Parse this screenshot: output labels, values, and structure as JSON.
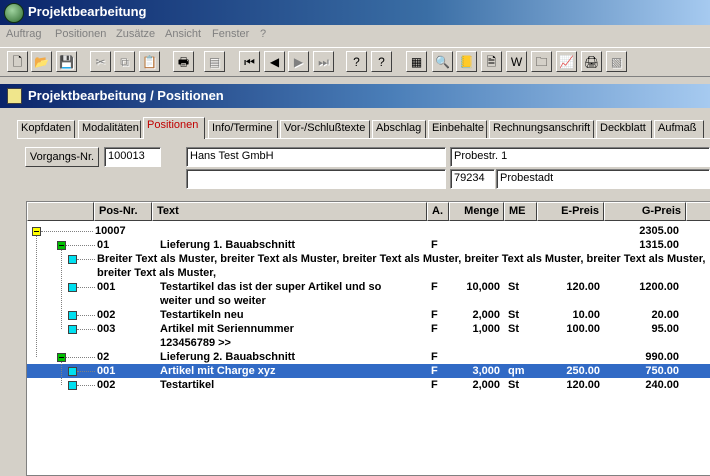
{
  "app": {
    "title": "Projektbearbeitung"
  },
  "menu": [
    "Auftrag",
    "Positionen",
    "Zusätze",
    "Ansicht",
    "Fenster",
    "?"
  ],
  "toolbar": {
    "buttons": [
      {
        "name": "new-icon",
        "glyph": "🗋"
      },
      {
        "name": "open-icon",
        "glyph": "📂"
      },
      {
        "name": "save-icon",
        "glyph": "💾"
      },
      {
        "name": "cut-icon",
        "glyph": "✂"
      },
      {
        "name": "copy-icon",
        "glyph": "⧉"
      },
      {
        "name": "paste-icon",
        "glyph": "📋"
      },
      {
        "name": "print-icon",
        "glyph": "🖶"
      },
      {
        "name": "print-preview-icon",
        "glyph": "▤"
      },
      {
        "name": "first-record-icon",
        "glyph": "⏮"
      },
      {
        "name": "previous-record-icon",
        "glyph": "◀"
      },
      {
        "name": "next-record-icon",
        "glyph": "▶"
      },
      {
        "name": "last-record-icon",
        "glyph": "⏭"
      },
      {
        "name": "help-icon",
        "glyph": "?"
      },
      {
        "name": "context-help-icon",
        "glyph": "?"
      },
      {
        "name": "calculator-icon",
        "glyph": "▦"
      },
      {
        "name": "search-icon",
        "glyph": "🔍"
      },
      {
        "name": "address-book-icon",
        "glyph": "📒"
      },
      {
        "name": "document-icon",
        "glyph": "🗎"
      },
      {
        "name": "word-icon",
        "glyph": "W"
      },
      {
        "name": "folder-icon",
        "glyph": "🗀"
      },
      {
        "name": "chart-icon",
        "glyph": "📈"
      },
      {
        "name": "printer-icon",
        "glyph": "🖨"
      },
      {
        "name": "disabled-tool-icon",
        "glyph": "▧"
      }
    ]
  },
  "window": {
    "title": "Projektbearbeitung / Positionen"
  },
  "tabs": [
    "Kopfdaten",
    "Modalitäten",
    "Positionen",
    "Info/Termine",
    "Vor-/Schlußtexte",
    "Abschlag",
    "Einbehalte",
    "Rechnungsanschrift",
    "Deckblatt",
    "Aufmaß"
  ],
  "header_fields": {
    "vorgang_button": "Vorgangs-Nr.",
    "vorgang_nr": "100013",
    "name1": "Hans Test GmbH",
    "name2": "",
    "street": "Probestr. 1",
    "zip": "79234",
    "city": "Probestadt"
  },
  "grid": {
    "columns": [
      "",
      "Pos-Nr.",
      "Text",
      "A.",
      "Menge",
      "ME",
      "E-Preis",
      "G-Preis"
    ],
    "rows": [
      {
        "lvl": 0,
        "node": "yellow",
        "pos": "10007",
        "text": "",
        "a": "",
        "menge": "",
        "me": "",
        "epreis": "",
        "gpreis": "2305.00"
      },
      {
        "lvl": 1,
        "node": "green",
        "pos": "01",
        "text": "Lieferung 1. Bauabschnitt",
        "a": "F",
        "menge": "",
        "me": "",
        "epreis": "",
        "gpreis": "1315.00"
      },
      {
        "lvl": 2,
        "node": "cyan",
        "pos": "",
        "text": "",
        "a": "",
        "menge": "",
        "me": "",
        "epreis": "",
        "gpreis": "",
        "fulltext": [
          "Breiter Text als Muster, breiter Text als Muster, breiter Text als Muster, breiter Text als Muster, breiter Text als Muster,",
          "breiter Text als Muster,"
        ]
      },
      {
        "lvl": 2,
        "node": "cyan",
        "pos": "001",
        "text": "Testartikel  das ist der super Artikel und so",
        "text2": "weiter und so weiter",
        "a": "F",
        "menge": "10,000",
        "me": "St",
        "epreis": "120.00",
        "gpreis": "1200.00"
      },
      {
        "lvl": 2,
        "node": "cyan",
        "pos": "002",
        "text": "Testartikeln neu",
        "a": "F",
        "menge": "2,000",
        "me": "St",
        "epreis": "10.00",
        "gpreis": "20.00"
      },
      {
        "lvl": 2,
        "node": "cyan",
        "pos": "003",
        "text": "Artikel mit Seriennummer",
        "text2": "123456789 >>",
        "a": "F",
        "menge": "1,000",
        "me": "St",
        "epreis": "100.00",
        "gpreis": "95.00"
      },
      {
        "lvl": 1,
        "node": "green",
        "pos": "02",
        "text": "Lieferung 2. Bauabschnitt",
        "a": "F",
        "menge": "",
        "me": "",
        "epreis": "",
        "gpreis": "990.00"
      },
      {
        "lvl": 2,
        "node": "cyan",
        "pos": "001",
        "text": "Artikel mit Charge xyz",
        "a": "F",
        "menge": "3,000",
        "me": "qm",
        "epreis": "250.00",
        "gpreis": "750.00",
        "selected": true
      },
      {
        "lvl": 2,
        "node": "cyan",
        "pos": "002",
        "text": "Testartikel",
        "a": "F",
        "menge": "2,000",
        "me": "St",
        "epreis": "120.00",
        "gpreis": "240.00"
      }
    ]
  },
  "colors": {
    "title_bar": "#0a246a",
    "selection": "#316ac5",
    "active_tab_text": "#c00000",
    "node_yellow": "#ffff00",
    "node_green": "#00c000",
    "node_cyan": "#00e0f0"
  }
}
